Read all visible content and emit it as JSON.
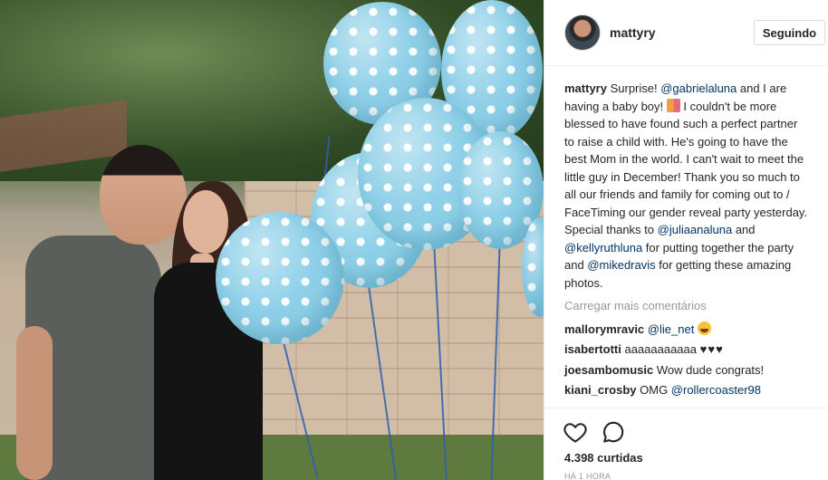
{
  "post": {
    "username": "mattyry",
    "follow_label": "Seguindo",
    "caption": {
      "t1": "Surprise! ",
      "m1": "@gabrielaluna",
      "t2": " and I are having a baby boy! ",
      "t3": " I couldn't be more blessed to have found such a perfect partner to raise a child with. He's going to have the best Mom in the world. I can't wait to meet the little guy in December! Thank you so much to all our friends and family for coming out to / FaceTiming our gender reveal party yesterday. Special thanks to ",
      "m2": "@juliaanaluna",
      "t4": " and ",
      "m3": "@kellyruthluna",
      "t5": " for putting together the party and ",
      "m4": "@mikedravis",
      "t6": " for getting these amazing photos."
    },
    "load_more": "Carregar mais comentários",
    "comments": [
      {
        "user": "mallorymravic",
        "mention": "@lie_net",
        "text": ""
      },
      {
        "user": "isabertotti",
        "mention": "",
        "text": "aaaaaaaaaaa ",
        "hearts": "♥♥♥"
      },
      {
        "user": "joesambomusic",
        "mention": "",
        "text": "Wow dude congrats!"
      },
      {
        "user": "kiani_crosby",
        "mention": "@rollercoaster98",
        "text": "OMG "
      }
    ],
    "likes": "4.398 curtidas",
    "timestamp": "HÁ 1 HORA"
  },
  "icons": {
    "like": "heart-icon",
    "comment": "comment-icon",
    "avatar": "avatar"
  },
  "colors": {
    "mention": "#003569",
    "muted": "#999999",
    "balloon": "#8fd0e8",
    "string": "#2f5fb0"
  }
}
